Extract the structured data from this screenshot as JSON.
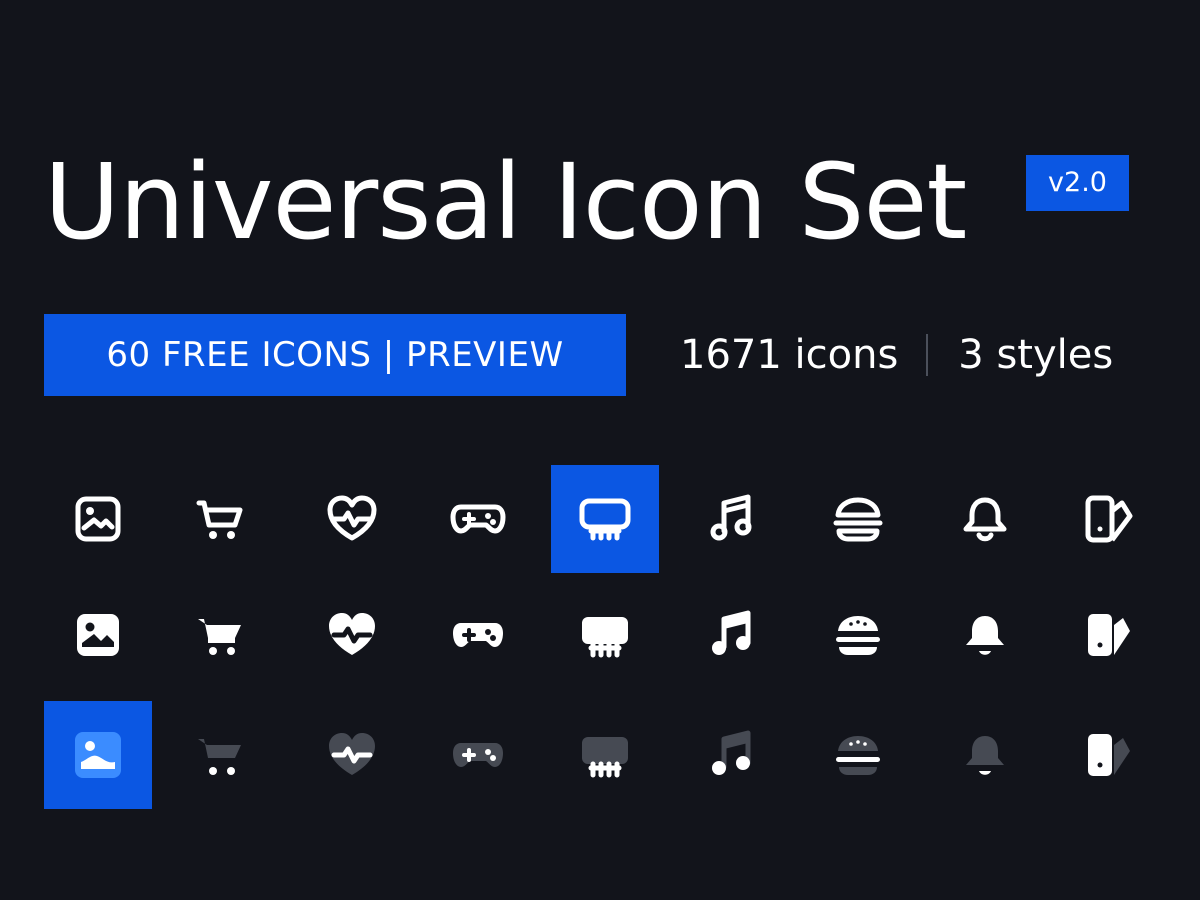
{
  "title": "Universal Icon Set",
  "version": "v2.0",
  "badge": "60 FREE ICONS | PREVIEW",
  "stats": {
    "icons": "1671 icons",
    "styles": "3 styles"
  },
  "colors": {
    "background": "#12141b",
    "accent": "#0b57e3",
    "text": "#ffffff",
    "divider": "#4b505b",
    "muted": "#464a53"
  },
  "icons": [
    "image",
    "shopping-cart",
    "heartbeat",
    "gamepad",
    "keyboard",
    "music-note",
    "burger",
    "bell",
    "swatches"
  ],
  "styles": [
    "outline",
    "solid",
    "duotone"
  ]
}
